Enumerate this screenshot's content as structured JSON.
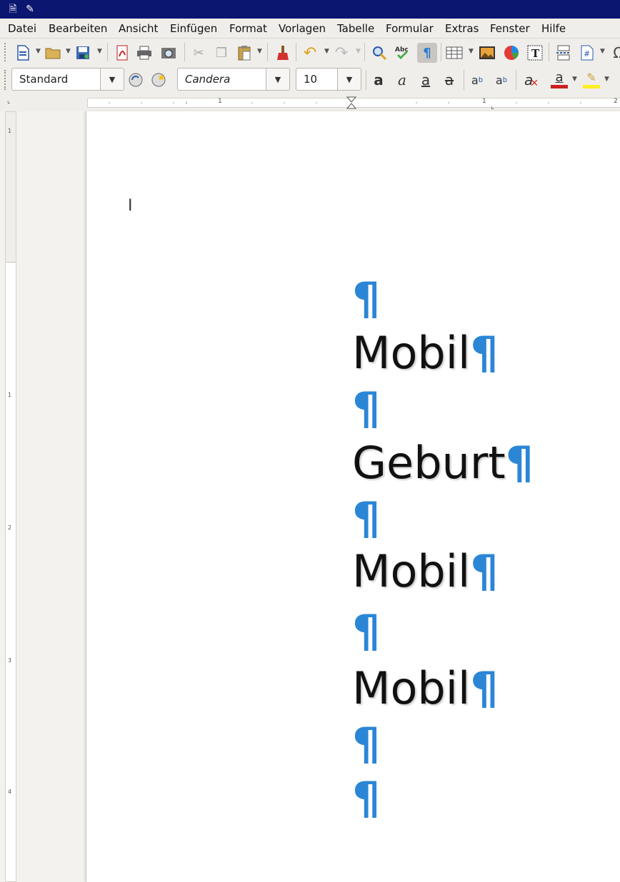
{
  "app": {
    "icons": {
      "doc": "document-icon",
      "pin": "pin-icon"
    }
  },
  "menu": [
    "Datei",
    "Bearbeiten",
    "Ansicht",
    "Einfügen",
    "Format",
    "Vorlagen",
    "Tabelle",
    "Formular",
    "Extras",
    "Fenster",
    "Hilfe"
  ],
  "formatting": {
    "paragraph_style": "Standard",
    "font_name": "Candera",
    "font_size": "10"
  },
  "ruler": {
    "h_labels": [
      "1",
      "1",
      "2"
    ],
    "v_labels": [
      "1",
      "1",
      "2",
      "3",
      "4"
    ]
  },
  "document": {
    "pilcrow": "¶",
    "paragraphs": [
      "",
      "Mobil",
      "",
      "Geburt",
      "",
      "Mobil",
      "",
      "Mobil",
      "",
      ""
    ]
  },
  "colors": {
    "accent": "#2b86d6",
    "titlebar": "#0a1670"
  }
}
